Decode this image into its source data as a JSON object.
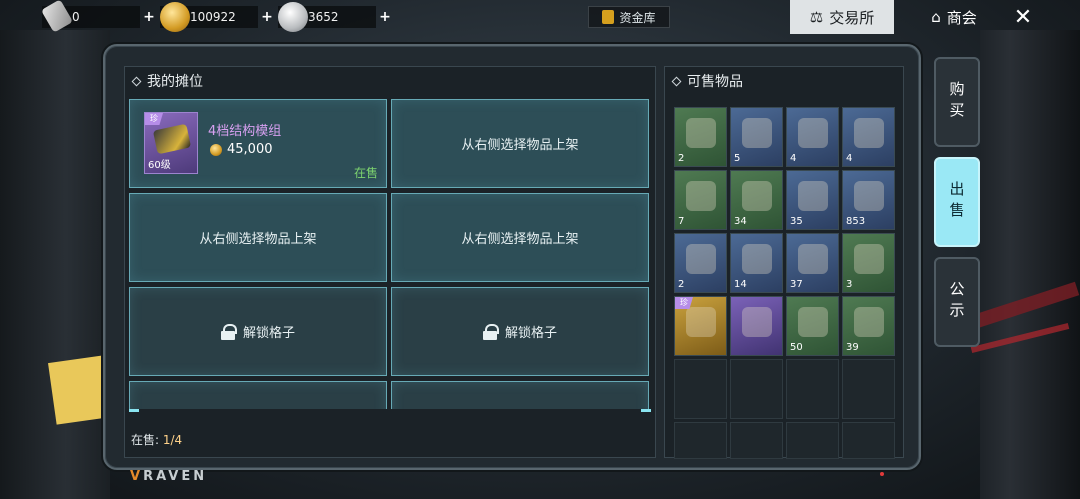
{
  "topbar": {
    "currencies": [
      {
        "icon": "certificate-icon",
        "value": "0"
      },
      {
        "icon": "gold-coin-icon",
        "value": "100922"
      },
      {
        "icon": "silver-coin-icon",
        "value": "3652"
      }
    ],
    "plus_label": "+",
    "fund_button": "资金库",
    "tab_exchange": "交易所",
    "tab_guild": "商会",
    "close_symbol": "✕"
  },
  "left_panel": {
    "title": "我的摊位",
    "listed_item": {
      "badge": "珍",
      "level": "60级",
      "name": "4档结构模组",
      "price": "45,000",
      "status": "在售"
    },
    "empty_slot_label": "从右侧选择物品上架",
    "locked_slot_label": "解锁格子",
    "on_sale_label": "在售:",
    "on_sale_count": "1/4"
  },
  "right_panel": {
    "title": "可售物品",
    "items": [
      {
        "name": "leather-hide",
        "qty": "2",
        "rarity": "green"
      },
      {
        "name": "rolled-leather",
        "qty": "5",
        "rarity": "blue"
      },
      {
        "name": "wood-plank",
        "qty": "4",
        "rarity": "blue"
      },
      {
        "name": "horn",
        "qty": "4",
        "rarity": "blue"
      },
      {
        "name": "salt",
        "qty": "7",
        "rarity": "green"
      },
      {
        "name": "golden-log",
        "qty": "34",
        "rarity": "green"
      },
      {
        "name": "cotton",
        "qty": "35",
        "rarity": "blue"
      },
      {
        "name": "battery-box",
        "qty": "853",
        "rarity": "blue"
      },
      {
        "name": "tusk",
        "qty": "2",
        "rarity": "blue"
      },
      {
        "name": "wood-log",
        "qty": "14",
        "rarity": "blue"
      },
      {
        "name": "cotton",
        "qty": "37",
        "rarity": "blue"
      },
      {
        "name": "medkit",
        "qty": "3",
        "rarity": "green"
      },
      {
        "name": "gold-blueprint",
        "qty": "",
        "rarity": "gold",
        "badge": "珍"
      },
      {
        "name": "purple-blueprint",
        "qty": "",
        "rarity": "purple"
      },
      {
        "name": "salt",
        "qty": "50",
        "rarity": "green"
      },
      {
        "name": "ore",
        "qty": "39",
        "rarity": "green"
      }
    ]
  },
  "side_tabs": {
    "buy": "购买",
    "sell": "出售",
    "notice": "公示"
  },
  "footer": {
    "logo": "RAVEN"
  },
  "colors": {
    "slot_bg": "#2d4e57",
    "slot_border": "#67aab6",
    "active_tab": "#9ae8f5",
    "status_green": "#7dd46f",
    "item_name_purple": "#d7a0f0"
  }
}
